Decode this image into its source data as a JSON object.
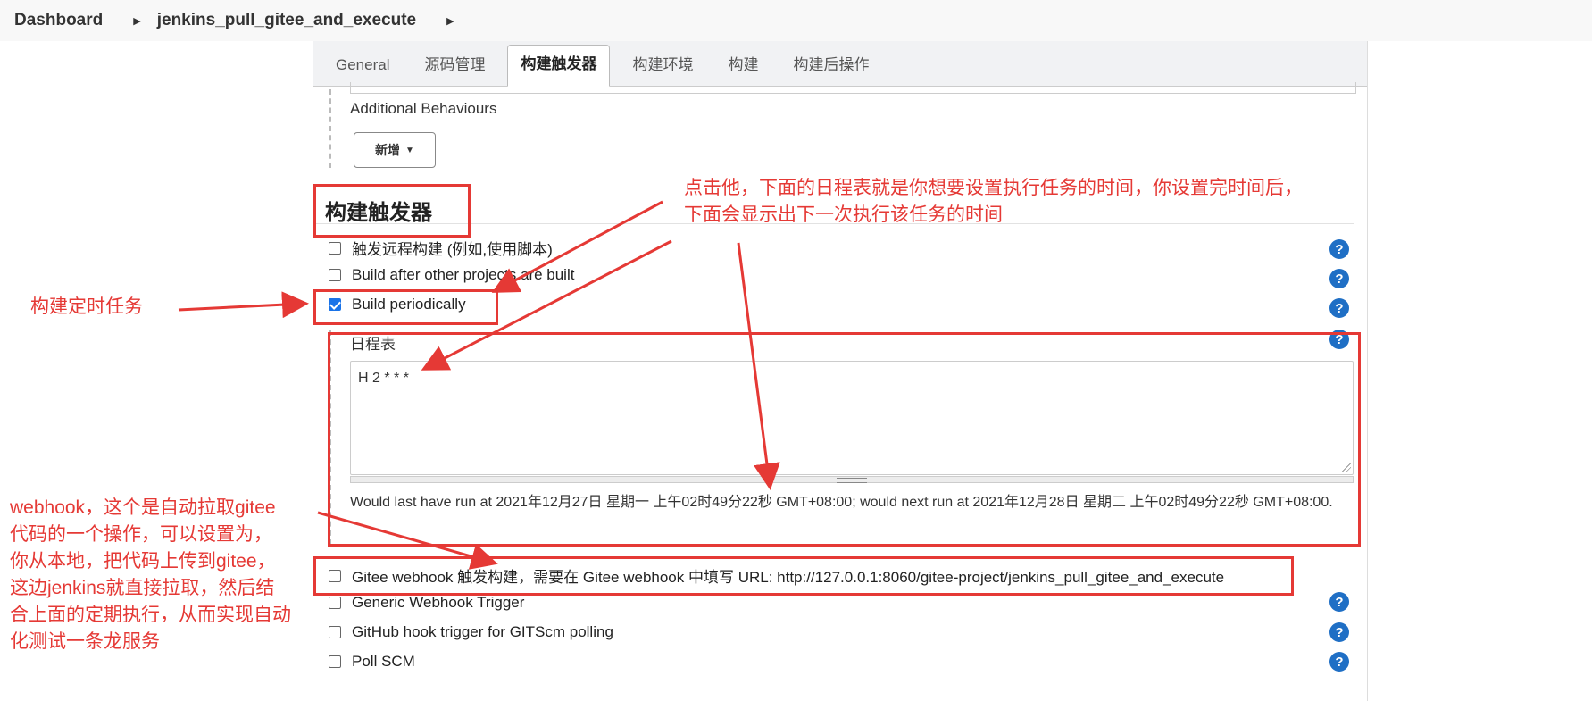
{
  "breadcrumb": {
    "items": [
      "Dashboard",
      "jenkins_pull_gitee_and_execute"
    ]
  },
  "tabs": [
    "General",
    "源码管理",
    "构建触发器",
    "构建环境",
    "构建",
    "构建后操作"
  ],
  "active_tab": "构建触发器",
  "additional": {
    "label": "Additional Behaviours",
    "add_button": "新增"
  },
  "section": {
    "title": "构建触发器"
  },
  "triggers": [
    {
      "label": "触发远程构建 (例如,使用脚本)",
      "checked": false
    },
    {
      "label": "Build after other projects are built",
      "checked": false
    },
    {
      "label": "Build periodically",
      "checked": true
    },
    {
      "label": "Gitee webhook 触发构建，需要在 Gitee webhook 中填写 URL: http://127.0.0.1:8060/gitee-project/jenkins_pull_gitee_and_execute",
      "checked": false
    },
    {
      "label": "Generic Webhook Trigger",
      "checked": false
    },
    {
      "label": "GitHub hook trigger for GITScm polling",
      "checked": false
    },
    {
      "label": "Poll SCM",
      "checked": false
    }
  ],
  "schedule": {
    "label": "日程表",
    "value": "H 2 * * *",
    "next_run": "Would last have run at 2021年12月27日 星期一 上午02时49分22秒 GMT+08:00; would next run at 2021年12月28日 星期二 上午02时49分22秒 GMT+08:00."
  },
  "help_icon": "?",
  "annotations": {
    "top": [
      "点击他，下面的日程表就是你想要设置执行任务的时间，你设置完时间后，",
      "下面会显示出下一次执行该任务的时间"
    ],
    "left": "构建定时任务",
    "webhook": [
      "webhook，这个是自动拉取gitee",
      "代码的一个操作，可以设置为，",
      "你从本地，把代码上传到gitee，",
      "这边jenkins就直接拉取，然后结",
      "合上面的定期执行，从而实现自动",
      "化测试一条龙服务"
    ]
  },
  "colors": {
    "annotation": "#e53935",
    "help": "#1f6fc5",
    "checkbox": "#1a73e8"
  }
}
